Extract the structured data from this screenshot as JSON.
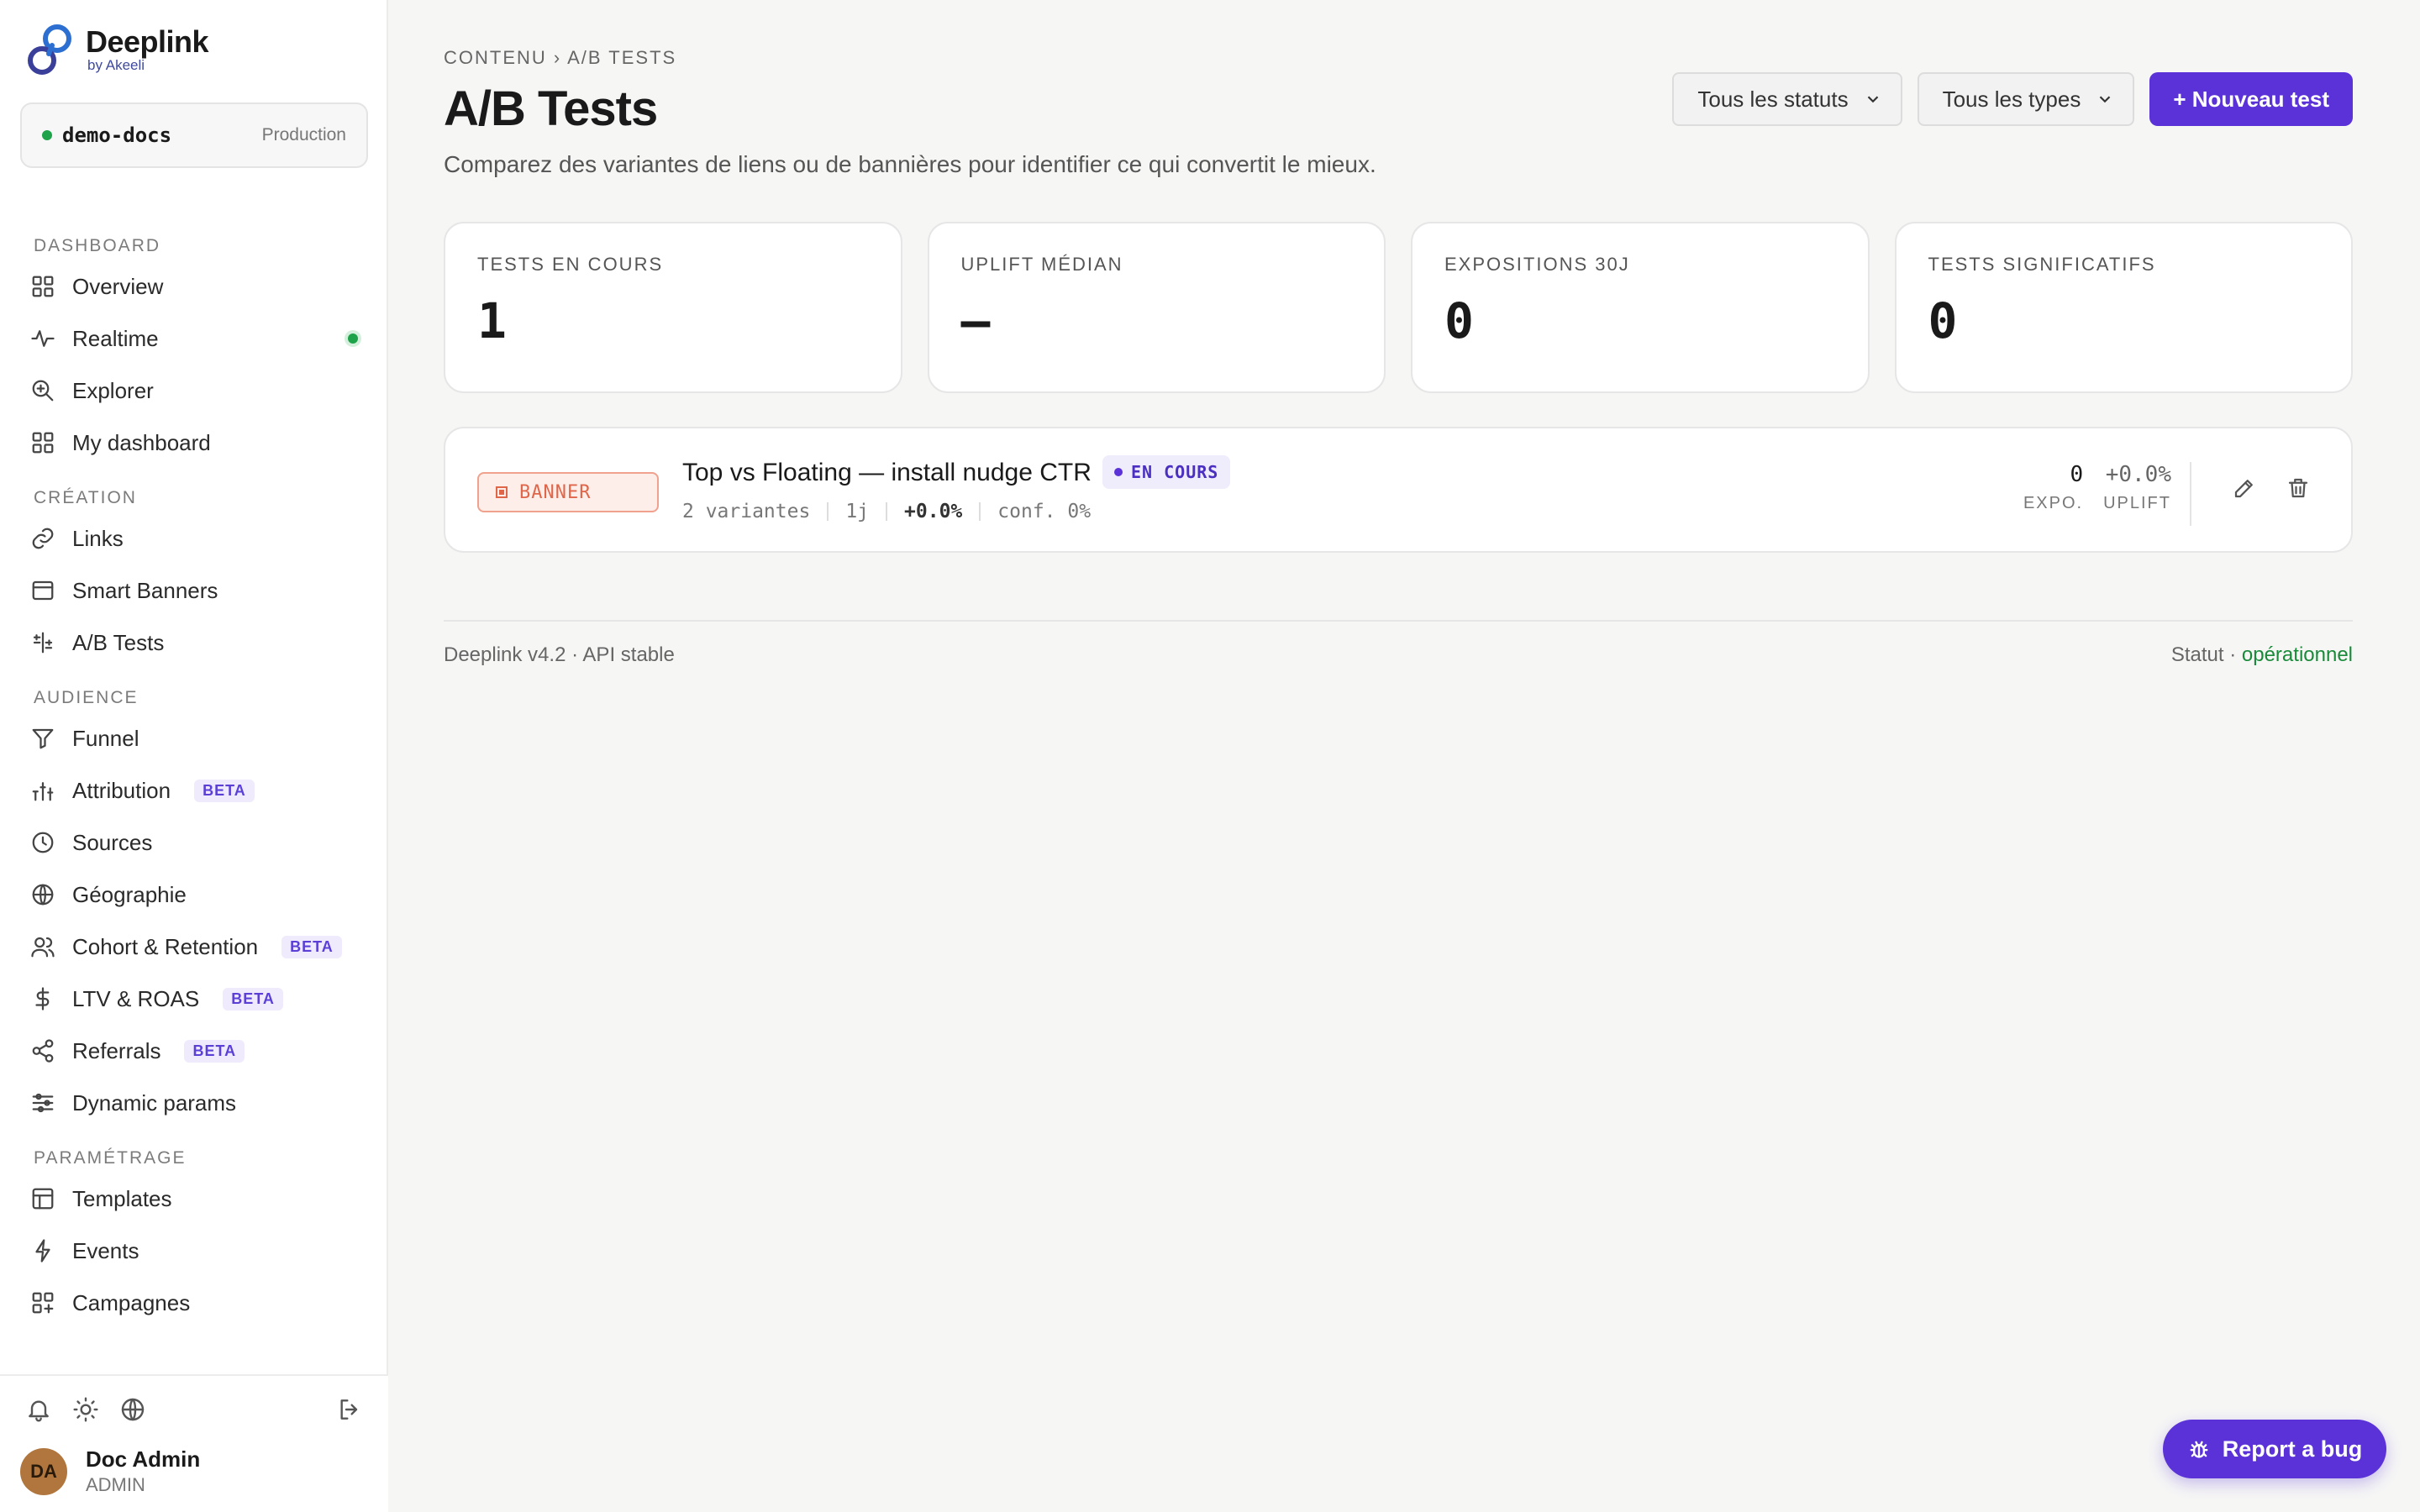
{
  "brand": {
    "name": "Deeplink",
    "sub": "by Akeeli"
  },
  "environment": {
    "name": "demo-docs",
    "tag": "Production"
  },
  "sidebar": {
    "sections": [
      {
        "title": "DASHBOARD",
        "items": [
          {
            "label": "Overview",
            "icon": "grid-icon"
          },
          {
            "label": "Realtime",
            "icon": "pulse-icon",
            "live": true
          },
          {
            "label": "Explorer",
            "icon": "zoom-icon"
          },
          {
            "label": "My dashboard",
            "icon": "grid-icon"
          }
        ]
      },
      {
        "title": "CRÉATION",
        "items": [
          {
            "label": "Links",
            "icon": "link-icon"
          },
          {
            "label": "Smart Banners",
            "icon": "window-icon"
          },
          {
            "label": "A/B Tests",
            "icon": "split-icon"
          }
        ]
      },
      {
        "title": "AUDIENCE",
        "items": [
          {
            "label": "Funnel",
            "icon": "funnel-icon"
          },
          {
            "label": "Attribution",
            "icon": "bars-icon",
            "badge": "BETA"
          },
          {
            "label": "Sources",
            "icon": "clock-icon"
          },
          {
            "label": "Géographie",
            "icon": "globe-icon"
          },
          {
            "label": "Cohort & Retention",
            "icon": "users-icon",
            "badge": "BETA"
          },
          {
            "label": "LTV & ROAS",
            "icon": "dollar-icon",
            "badge": "BETA"
          },
          {
            "label": "Referrals",
            "icon": "share-icon",
            "badge": "BETA"
          },
          {
            "label": "Dynamic params",
            "icon": "sliders-icon"
          }
        ]
      },
      {
        "title": "PARAMÉTRAGE",
        "items": [
          {
            "label": "Templates",
            "icon": "layout-icon"
          },
          {
            "label": "Events",
            "icon": "bolt-icon"
          },
          {
            "label": "Campagnes",
            "icon": "grid-plus-icon"
          }
        ]
      }
    ]
  },
  "user": {
    "initials": "DA",
    "name": "Doc Admin",
    "role": "ADMIN"
  },
  "page": {
    "breadcrumb": "CONTENU › A/B TESTS",
    "title": "A/B Tests",
    "description": "Comparez des variantes de liens ou de bannières pour identifier ce qui convertit le mieux."
  },
  "filters": {
    "status": "Tous les statuts",
    "type": "Tous les types",
    "new_button": "+ Nouveau test"
  },
  "stats": [
    {
      "label": "TESTS EN COURS",
      "value": "1"
    },
    {
      "label": "UPLIFT MÉDIAN",
      "value": "—"
    },
    {
      "label": "EXPOSITIONS 30J",
      "value": "0"
    },
    {
      "label": "TESTS SIGNIFICATIFS",
      "value": "0"
    }
  ],
  "tests": [
    {
      "type": "BANNER",
      "title": "Top vs Floating — install nudge CTR",
      "status": "EN COURS",
      "variants": "2 variantes",
      "duration": "1j",
      "uplift_meta": "+0.0%",
      "confidence": "conf. 0%",
      "expo_value": "0",
      "expo_label": "EXPO.",
      "uplift_value": "+0.0%",
      "uplift_label": "UPLIFT"
    }
  ],
  "footer": {
    "version": "Deeplink v4.2 · API stable",
    "status_prefix": "Statut · ",
    "status_value": "opérationnel"
  },
  "report_bug": "Report a bug",
  "colors": {
    "accent": "#5a32d8",
    "live": "#1fa34a",
    "banner": "#e0664a"
  }
}
